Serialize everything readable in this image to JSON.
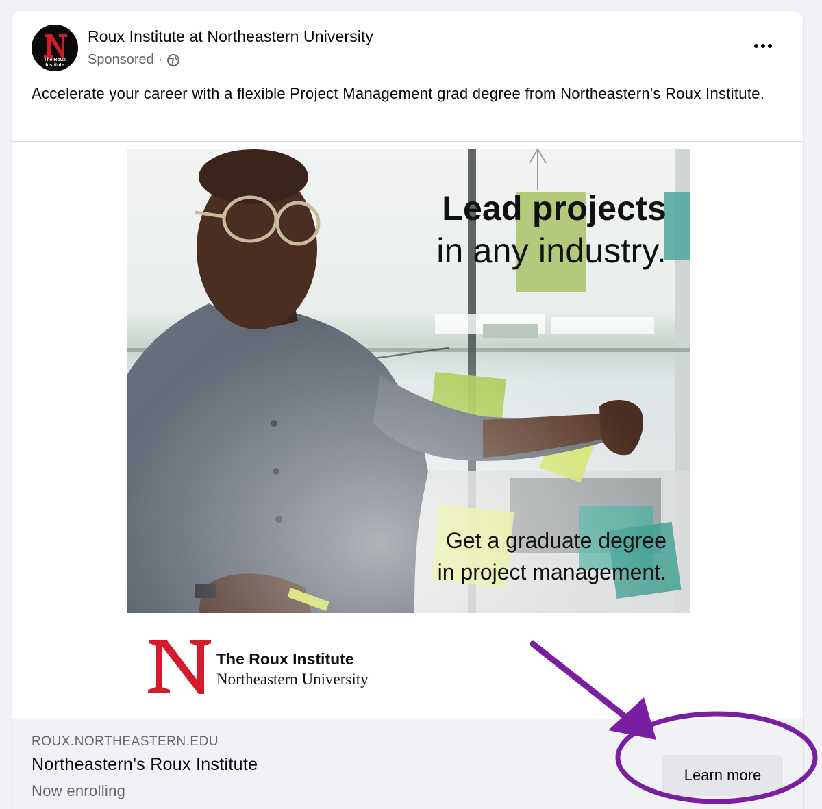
{
  "post": {
    "page_name": "Roux Institute at Northeastern University",
    "sponsored_label": "Sponsored",
    "separator": "·",
    "caption": "Accelerate your career with a flexible Project Management grad degree from Northeastern's Roux Institute.",
    "avatar_logo_text": [
      "The Roux",
      "Institute"
    ],
    "avatar_letter": "N"
  },
  "creative": {
    "headline_bold": "Lead projects",
    "headline_regular": "in any industry.",
    "subhead_line1": "Get a graduate degree",
    "subhead_line2": "in project management.",
    "logo_line1": "The Roux Institute",
    "logo_line2": "Northeastern University",
    "logo_letter": "N"
  },
  "link": {
    "domain": "ROUX.NORTHEASTERN.EDU",
    "title": "Northeastern's Roux Institute",
    "description": "Now enrolling",
    "cta_label": "Learn more"
  },
  "colors": {
    "brand_red": "#d41b2c",
    "annotation_purple": "#7a1fa2",
    "cta_bg": "#e4e6eb"
  },
  "icons": [
    "globe-icon",
    "more-options-icon",
    "northeastern-n-logo",
    "annotation-arrow",
    "annotation-circle"
  ]
}
